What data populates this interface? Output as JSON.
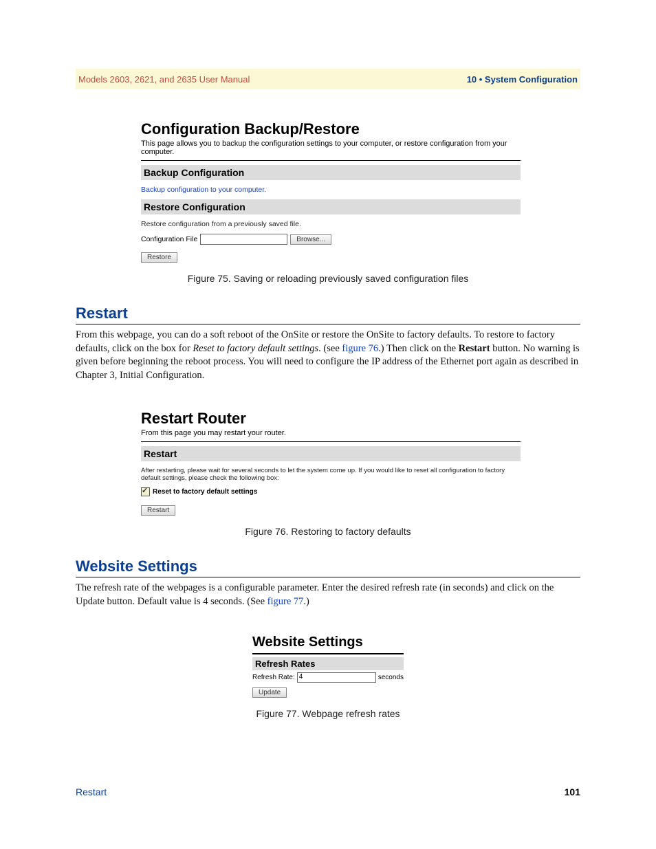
{
  "header": {
    "left": "Models 2603, 2621, and 2635 User Manual",
    "right": "10 • System Configuration"
  },
  "fig75": {
    "title": "Configuration Backup/Restore",
    "lead": "This page allows you to backup the configuration settings to your computer, or restore configuration from your computer.",
    "backup_hdr": "Backup Configuration",
    "backup_link": "Backup configuration to your computer.",
    "restore_hdr": "Restore Configuration",
    "restore_desc": "Restore configuration from a previously saved file.",
    "file_label": "Configuration File",
    "browse": "Browse...",
    "restore_btn": "Restore",
    "caption": "Figure 75. Saving or reloading previously saved configuration files"
  },
  "restart": {
    "heading": "Restart",
    "p_pre": "From this webpage, you can do a soft reboot of the OnSite or restore the OnSite to factory defaults. To restore to factory defaults, click on the box for ",
    "p_em": "Reset to factory default settings",
    "p_mid": ". (see ",
    "p_link": "figure 76",
    "p_post1": ".) Then click on the ",
    "p_bold": "Restart",
    "p_post2": " button. No warning is given before beginning the reboot process. You will need to configure the IP address of the Ethernet port again as described in Chapter 3, Initial Configuration."
  },
  "fig76": {
    "title": "Restart Router",
    "lead": "From this page you may restart your router.",
    "hdr": "Restart",
    "desc": "After restarting, please wait for several seconds to let the system come up. If you would like to reset all configuration to factory default settings, please check the following box:",
    "chk_label": "Reset to factory default settings",
    "btn": "Restart",
    "caption": "Figure 76. Restoring to factory defaults"
  },
  "website": {
    "heading": "Website Settings",
    "p_pre": "The refresh rate of the webpages is a configurable parameter. Enter the desired refresh rate (in seconds) and click on the Update button. Default value is 4 seconds. (See ",
    "p_link": "figure 77",
    "p_post": ".)"
  },
  "fig77": {
    "title": "Website Settings",
    "hdr": "Refresh Rates",
    "label": "Refresh Rate:",
    "value": "4",
    "unit": "seconds",
    "btn": "Update",
    "caption": "Figure 77. Webpage refresh rates"
  },
  "footer": {
    "left": "Restart",
    "right": "101"
  }
}
